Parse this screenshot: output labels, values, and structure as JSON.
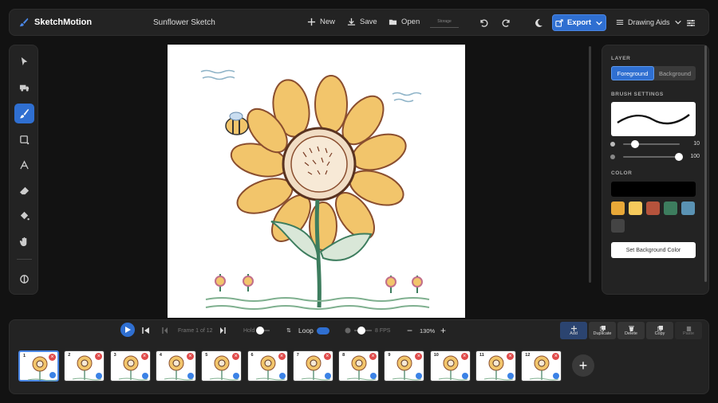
{
  "app": {
    "name": "SketchMotion",
    "doc_title": "Sunflower Sketch"
  },
  "toolbar": {
    "new_label": "New",
    "save_label": "Save",
    "open_label": "Open",
    "storage_label": "Storage",
    "export_label": "Export",
    "drawing_aids_label": "Drawing Aids"
  },
  "tools": [
    "select-tool",
    "move-tool",
    "brush-tool",
    "shape-tool",
    "text-tool",
    "eraser-tool",
    "fill-tool",
    "hand-tool",
    "eyedropper-tool"
  ],
  "panel": {
    "layer_label": "LAYER",
    "layer_tabs": [
      "Foreground",
      "Background"
    ],
    "brush_settings_label": "BRUSH SETTINGS",
    "size_value": "10",
    "size_level": 0.15,
    "opacity_value": "100",
    "opacity_level": 1.0,
    "color_label": "COLOR",
    "current_color": "#000000",
    "swatches": [
      "#e8a838",
      "#f5c95c",
      "#b5533c",
      "#3d7d5e",
      "#5a92b3",
      "#444444"
    ],
    "bg_button": "Set Background Color"
  },
  "playback": {
    "frame_label": "Frame 1 of 12",
    "hold_label": "Hold",
    "hold_icon_label": "⇅",
    "loop_label": "Loop",
    "fps_label": "8 FPS",
    "zoom_label": "130%"
  },
  "frame_tools": [
    "Add",
    "Duplicate",
    "Delete",
    "Copy",
    "Paste"
  ],
  "frames": [
    "1",
    "2",
    "3",
    "4",
    "5",
    "6",
    "7",
    "8",
    "9",
    "10",
    "11",
    "12"
  ],
  "accent": "#2f6fd1"
}
